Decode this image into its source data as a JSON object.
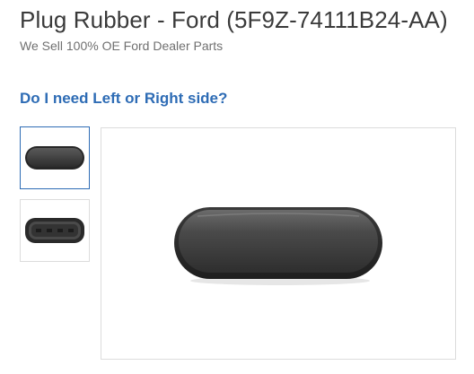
{
  "product": {
    "title": "Plug Rubber - Ford (5F9Z-74111B24-AA)",
    "subtitle": "We Sell 100% OE Ford Dealer Parts",
    "side_question": "Do I need Left or Right side?"
  },
  "gallery": {
    "thumbnails": [
      {
        "icon": "rubber-plug-top-view-image",
        "selected": true
      },
      {
        "icon": "rubber-plug-bottom-view-image",
        "selected": false
      }
    ],
    "main_image_icon": "rubber-plug-image"
  },
  "colors": {
    "title": "#3a3a3a",
    "link": "#2e6cb5",
    "selected_border": "#2e6cb5",
    "frame_border": "#dcdcdc"
  }
}
